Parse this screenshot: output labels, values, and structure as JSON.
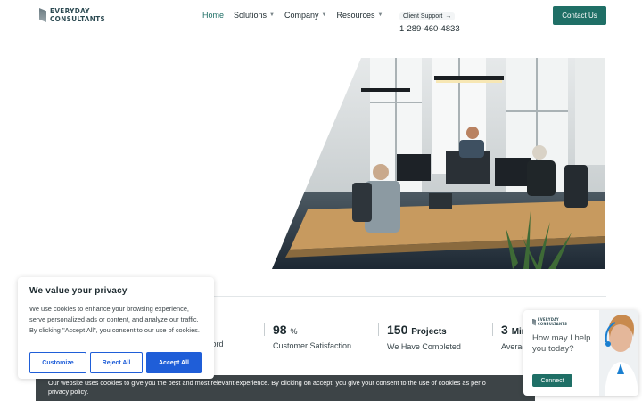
{
  "header": {
    "logo_line1": "EVERYDAY",
    "logo_line2": "CONSULTANTS",
    "nav": [
      {
        "label": "Home",
        "active": true
      },
      {
        "label": "Solutions",
        "dropdown": true
      },
      {
        "label": "Company",
        "dropdown": true
      },
      {
        "label": "Resources",
        "dropdown": true
      }
    ],
    "support_label": "Client Support",
    "support_arrow": "→",
    "phone": "1-289-460-4833",
    "contact_button": "Contact Us"
  },
  "stats": [
    {
      "value": "",
      "unit": "",
      "label": "ecord"
    },
    {
      "value": "98",
      "unit": "%",
      "label": "Customer Satisfaction"
    },
    {
      "value": "150",
      "unit": "Projects",
      "label": "We Have Completed"
    },
    {
      "value": "3",
      "unit": "Min",
      "label": "Averag"
    }
  ],
  "privacy_modal": {
    "title": "We value your privacy",
    "body": "We use cookies to enhance your browsing experience, serve personalized ads or content, and analyze our traffic. By clicking \"Accept All\", you consent to our use of cookies.",
    "customize": "Customize",
    "reject": "Reject All",
    "accept": "Accept All"
  },
  "cookie_bar": {
    "text": "Our website uses cookies to give you the best and most relevant experience. By clicking on accept, you give your consent to the use of cookies as per o",
    "text2": "privacy policy."
  },
  "chat_widget": {
    "logo_line1": "EVERYDAY",
    "logo_line2": "CONSULTANTS",
    "question": "How may I help you today?",
    "button": "Connect"
  },
  "colors": {
    "brand": "#1f6f66",
    "accent_blue": "#1f5ed8",
    "cookie_bar_bg": "#3d4447"
  },
  "icons": {
    "nav_dropdown": "chevron-down-icon",
    "support_arrow": "arrow-right-icon"
  }
}
